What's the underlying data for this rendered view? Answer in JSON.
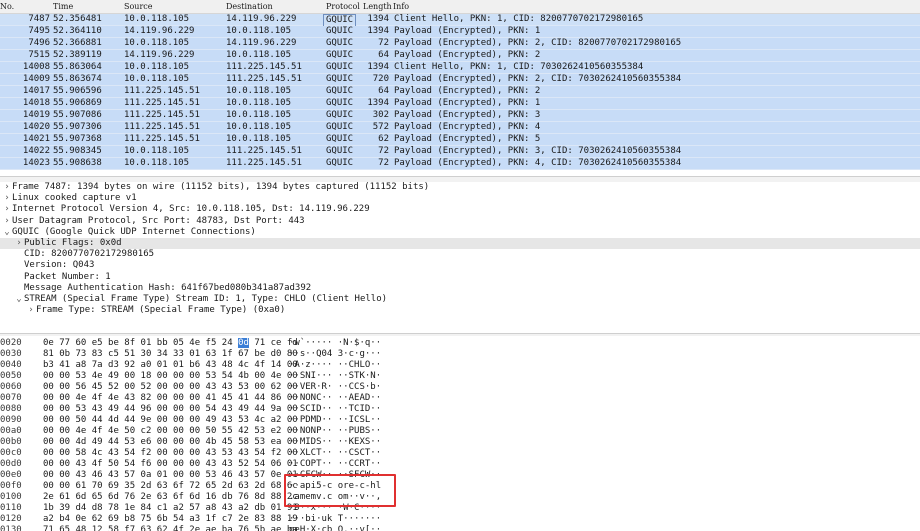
{
  "packet_list": {
    "columns": [
      "No.",
      "Time",
      "Source",
      "Destination",
      "Protocol",
      "Length",
      "Info"
    ],
    "rows": [
      {
        "no": "7487",
        "time": "52.356481",
        "src": "10.0.118.105",
        "dst": "14.119.96.229",
        "proto": "GQUIC",
        "len": "1394",
        "info": "Client Hello, PKN: 1, CID: 8200770702172980165"
      },
      {
        "no": "7495",
        "time": "52.364110",
        "src": "14.119.96.229",
        "dst": "10.0.118.105",
        "proto": "GQUIC",
        "len": "1394",
        "info": "Payload (Encrypted), PKN: 1"
      },
      {
        "no": "7496",
        "time": "52.366881",
        "src": "10.0.118.105",
        "dst": "14.119.96.229",
        "proto": "GQUIC",
        "len": "72",
        "info": "Payload (Encrypted), PKN: 2, CID: 8200770702172980165"
      },
      {
        "no": "7515",
        "time": "52.389119",
        "src": "14.119.96.229",
        "dst": "10.0.118.105",
        "proto": "GQUIC",
        "len": "64",
        "info": "Payload (Encrypted), PKN: 2"
      },
      {
        "no": "14008",
        "time": "55.863064",
        "src": "10.0.118.105",
        "dst": "111.225.145.51",
        "proto": "GQUIC",
        "len": "1394",
        "info": "Client Hello, PKN: 1, CID: 7030262410560355384"
      },
      {
        "no": "14009",
        "time": "55.863674",
        "src": "10.0.118.105",
        "dst": "111.225.145.51",
        "proto": "GQUIC",
        "len": "720",
        "info": "Payload (Encrypted), PKN: 2, CID: 7030262410560355384"
      },
      {
        "no": "14017",
        "time": "55.906596",
        "src": "111.225.145.51",
        "dst": "10.0.118.105",
        "proto": "GQUIC",
        "len": "64",
        "info": "Payload (Encrypted), PKN: 2"
      },
      {
        "no": "14018",
        "time": "55.906869",
        "src": "111.225.145.51",
        "dst": "10.0.118.105",
        "proto": "GQUIC",
        "len": "1394",
        "info": "Payload (Encrypted), PKN: 1"
      },
      {
        "no": "14019",
        "time": "55.907086",
        "src": "111.225.145.51",
        "dst": "10.0.118.105",
        "proto": "GQUIC",
        "len": "302",
        "info": "Payload (Encrypted), PKN: 3"
      },
      {
        "no": "14020",
        "time": "55.907306",
        "src": "111.225.145.51",
        "dst": "10.0.118.105",
        "proto": "GQUIC",
        "len": "572",
        "info": "Payload (Encrypted), PKN: 4"
      },
      {
        "no": "14021",
        "time": "55.907368",
        "src": "111.225.145.51",
        "dst": "10.0.118.105",
        "proto": "GQUIC",
        "len": "62",
        "info": "Payload (Encrypted), PKN: 5"
      },
      {
        "no": "14022",
        "time": "55.908345",
        "src": "10.0.118.105",
        "dst": "111.225.145.51",
        "proto": "GQUIC",
        "len": "72",
        "info": "Payload (Encrypted), PKN: 3, CID: 7030262410560355384"
      },
      {
        "no": "14023",
        "time": "55.908638",
        "src": "10.0.118.105",
        "dst": "111.225.145.51",
        "proto": "GQUIC",
        "len": "72",
        "info": "Payload (Encrypted), PKN: 4, CID: 7030262410560355384"
      }
    ]
  },
  "details": [
    {
      "arrow": "›",
      "indent": 0,
      "text": "Frame 7487: 1394 bytes on wire (11152 bits), 1394 bytes captured (11152 bits)"
    },
    {
      "arrow": "›",
      "indent": 0,
      "text": "Linux cooked capture v1"
    },
    {
      "arrow": "›",
      "indent": 0,
      "text": "Internet Protocol Version 4, Src: 10.0.118.105, Dst: 14.119.96.229"
    },
    {
      "arrow": "›",
      "indent": 0,
      "text": "User Datagram Protocol, Src Port: 48783, Dst Port: 443"
    },
    {
      "arrow": "⌄",
      "indent": 0,
      "text": "GQUIC (Google Quick UDP Internet Connections)"
    },
    {
      "arrow": "›",
      "indent": 1,
      "text": "Public Flags: 0x0d",
      "highlight": true
    },
    {
      "arrow": "",
      "indent": 1,
      "text": "CID: 8200770702172980165"
    },
    {
      "arrow": "",
      "indent": 1,
      "text": "Version: Q043"
    },
    {
      "arrow": "",
      "indent": 1,
      "text": "Packet Number: 1"
    },
    {
      "arrow": "",
      "indent": 1,
      "text": "Message Authentication Hash: 641f67bed080b341a87ad392"
    },
    {
      "arrow": "⌄",
      "indent": 1,
      "text": "STREAM (Special Frame Type) Stream ID: 1, Type: CHLO (Client Hello)"
    },
    {
      "arrow": "›",
      "indent": 2,
      "text": "Frame Type: STREAM (Special Frame Type) (0xa0)"
    }
  ],
  "bytes": [
    {
      "off": "0020",
      "hex": "0e 77 60 e5 be 8f 01 bb  05 4e f5 24 0d 71 ce fd",
      "asc": "·w`·····  ·N·$·q··"
    },
    {
      "off": "0030",
      "hex": "81 0b 73 83 c5 51 30 34  33 01 63 1f 67 be d0 80",
      "asc": "··s··Q04 3·c·g···"
    },
    {
      "off": "0040",
      "hex": "b3 41 a8 7a d3 92 a0 01  01 b6 43 48 4c 4f 14 00",
      "asc": "·A·z···· ··CHLO··"
    },
    {
      "off": "0050",
      "hex": "00 00 53 4e 49 00 18 00  00 00 53 54 4b 00 4e 00",
      "asc": "··SNI··· ··STK·N·"
    },
    {
      "off": "0060",
      "hex": "00 00 56 45 52 00 52 00  00 00 43 43 53 00 62 00",
      "asc": "··VER·R· ··CCS·b·"
    },
    {
      "off": "0070",
      "hex": "00 00 4e 4f 4e 43 82 00  00 00 41 45 41 44 86 00",
      "asc": "··NONC·· ··AEAD··"
    },
    {
      "off": "0080",
      "hex": "00 00 53 43 49 44 96 00  00 00 54 43 49 44 9a 00",
      "asc": "··SCID·· ··TCID··"
    },
    {
      "off": "0090",
      "hex": "00 00 50 44 4d 44 9e 00  00 00 49 43 53 4c a2 00",
      "asc": "··PDMD·· ··ICSL··"
    },
    {
      "off": "00a0",
      "hex": "00 00 4e 4f 4e 50 c2 00  00 00 50 55 42 53 e2 00",
      "asc": "··NONP·· ··PUBS··"
    },
    {
      "off": "00b0",
      "hex": "00 00 4d 49 44 53 e6 00  00 00 4b 45 58 53 ea 00",
      "asc": "··MIDS·· ··KEXS··"
    },
    {
      "off": "00c0",
      "hex": "00 00 58 4c 43 54 f2 00  00 00 43 53 43 54 f2 00",
      "asc": "··XLCT·· ··CSCT··"
    },
    {
      "off": "00d0",
      "hex": "00 00 43 4f 50 54 f6 00  00 00 43 43 52 54 06 01",
      "asc": "··COPT·· ··CCRT··"
    },
    {
      "off": "00e0",
      "hex": "00 00 43 46 43 57 0a 01  00 00 53 46 43 57 0e 01",
      "asc": "··CFCW·· ··SFCW··"
    },
    {
      "off": "00f0",
      "hex": "00 00 61 70 69 35 2d 63  6f 72 65 2d 63 2d 68 6c",
      "asc": "··api5-c ore-c-hl"
    },
    {
      "off": "0100",
      "hex": "2e 61 6d 65 6d 76 2e 63  6f 6d 16 db 76 8d 88 2c",
      "asc": ".amemv.c om··v··,"
    },
    {
      "off": "0110",
      "hex": "1b 39 d4 d8 78 1e 84 c1  a2 57 a8 43 a2 db 01 91",
      "asc": "·9··x··· ·W·C····"
    },
    {
      "off": "0120",
      "hex": "a2 b4 0e 62 69 b8 75 6b  54 a3 1f c7 2e 83 88 19",
      "asc": "···bi·uk T·······"
    },
    {
      "off": "0130",
      "hex": "71 65 48 12 58 f7 63 62  4f 2e ae ba 76 5b ae ba",
      "asc": "qeH·X·cb O.··v[··"
    }
  ]
}
